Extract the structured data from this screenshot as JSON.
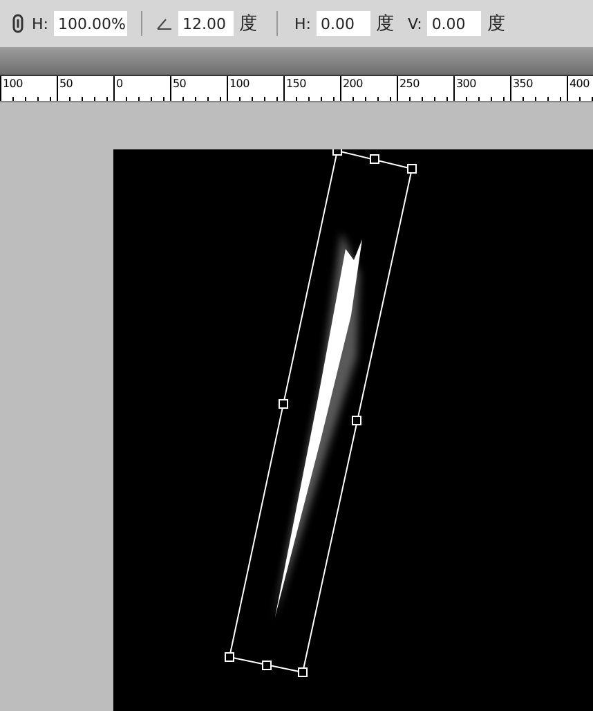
{
  "options_bar": {
    "fields": [
      {
        "label": "H:",
        "value": "100.00%",
        "kind": "scale"
      },
      {
        "value": "12.00",
        "unit": "度",
        "kind": "angle"
      },
      {
        "label": "H:",
        "value": "0.00",
        "unit": "度",
        "kind": "skew"
      },
      {
        "label": "V:",
        "value": "0.00",
        "unit": "度",
        "kind": "skew"
      }
    ]
  },
  "ruler": {
    "labels": [
      "100",
      "50",
      "0",
      "50",
      "100",
      "150",
      "200",
      "250",
      "300",
      "350",
      "400"
    ]
  }
}
